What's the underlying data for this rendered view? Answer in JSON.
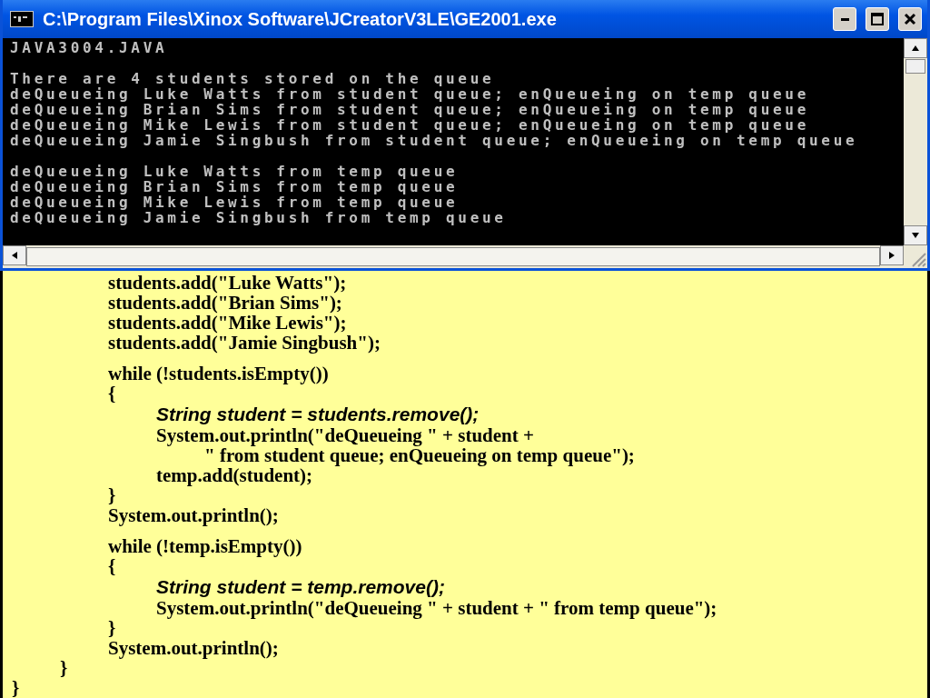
{
  "window": {
    "title": "C:\\Program Files\\Xinox Software\\JCreatorV3LE\\GE2001.exe"
  },
  "console": {
    "blocks": [
      [
        "JAVA3004.JAVA"
      ],
      [
        "There are 4 students stored on the queue",
        "deQueueing Luke Watts from student queue; enQueueing on temp queue",
        "deQueueing Brian Sims from student queue; enQueueing on temp queue",
        "deQueueing Mike Lewis from student queue; enQueueing on temp queue",
        "deQueueing Jamie Singbush from student queue; enQueueing on temp queue"
      ],
      [
        "deQueueing Luke Watts from temp queue",
        "deQueueing Brian Sims from temp queue",
        "deQueueing Mike Lewis from temp queue",
        "deQueueing Jamie Singbush from temp queue"
      ]
    ]
  },
  "code": [
    {
      "children": [
        {
          "children": [
            {
              "kind": "plain",
              "text": "students.add(\"Luke Watts\");"
            },
            {
              "kind": "plain",
              "text": "students.add(\"Brian Sims\");"
            },
            {
              "kind": "plain",
              "text": "students.add(\"Mike Lewis\");"
            },
            {
              "kind": "plain",
              "text": "students.add(\"Jamie Singbush\");"
            },
            {
              "kind": "plain",
              "text": "while (!students.isEmpty())",
              "spaced": true
            },
            {
              "kind": "plain",
              "text": "{"
            },
            {
              "children": [
                {
                  "kind": "emphasis",
                  "text": "String student = students.remove();"
                },
                {
                  "kind": "plain",
                  "text": "System.out.println(\"deQueueing \" + student +"
                },
                {
                  "children": [
                    {
                      "kind": "plain",
                      "text": "\" from student queue; enQueueing on temp queue\");"
                    }
                  ]
                },
                {
                  "kind": "plain",
                  "text": "temp.add(student);"
                }
              ]
            },
            {
              "kind": "plain",
              "text": "}"
            },
            {
              "kind": "plain",
              "text": "System.out.println();"
            },
            {
              "kind": "plain",
              "text": "while (!temp.isEmpty())",
              "spaced": true
            },
            {
              "kind": "plain",
              "text": "{"
            },
            {
              "children": [
                {
                  "kind": "emphasis",
                  "text": "String student = temp.remove();"
                },
                {
                  "kind": "plain",
                  "text": "System.out.println(\"deQueueing \" + student + \" from temp queue\");"
                }
              ]
            },
            {
              "kind": "plain",
              "text": "}"
            },
            {
              "kind": "plain",
              "text": "System.out.println();"
            }
          ]
        },
        {
          "kind": "plain",
          "text": "}"
        }
      ]
    },
    {
      "kind": "plain",
      "text": "}"
    }
  ]
}
